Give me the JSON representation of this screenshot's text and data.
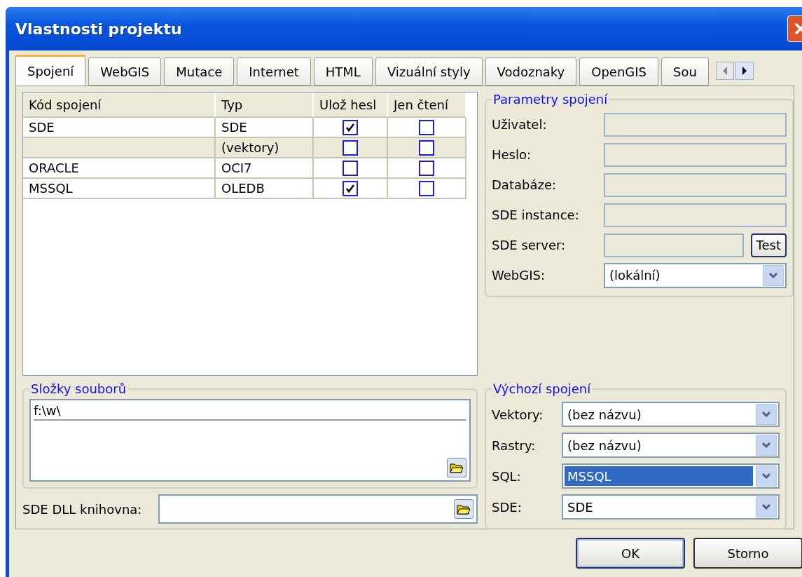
{
  "window": {
    "title": "Vlastnosti projektu"
  },
  "tabs": [
    {
      "label": "Spojení",
      "selected": true
    },
    {
      "label": "WebGIS",
      "selected": false
    },
    {
      "label": "Mutace",
      "selected": false
    },
    {
      "label": "Internet",
      "selected": false
    },
    {
      "label": "HTML",
      "selected": false
    },
    {
      "label": "Vizuální styly",
      "selected": false
    },
    {
      "label": "Vodoznaky",
      "selected": false
    },
    {
      "label": "OpenGIS",
      "selected": false
    },
    {
      "label": "Sou",
      "selected": false
    }
  ],
  "table": {
    "columns": [
      "Kód spojení",
      "Typ",
      "Ulož hesl",
      "Jen čtení"
    ],
    "rows": [
      {
        "code": "SDE",
        "type": "SDE",
        "save_password": true,
        "read_only": false,
        "selected": false
      },
      {
        "type": "(vektory)",
        "save_password": false,
        "read_only": false,
        "selected": true
      },
      {
        "code": "ORACLE",
        "type": "OCI7",
        "save_password": false,
        "read_only": false,
        "selected": false
      },
      {
        "code": "MSSQL",
        "type": "OLEDB",
        "save_password": true,
        "read_only": false,
        "selected": false
      }
    ]
  },
  "connection_params": {
    "title": "Parametry spojení",
    "fields": [
      {
        "label": "Uživatel:",
        "kind": "text"
      },
      {
        "label": "Heslo:",
        "kind": "text"
      },
      {
        "label": "Databáze:",
        "kind": "text"
      },
      {
        "label": "SDE instance:",
        "kind": "text"
      },
      {
        "label": "SDE server:",
        "kind": "button",
        "button": "Test"
      },
      {
        "label": "WebGIS:",
        "kind": "select",
        "value": "(lokální)"
      }
    ]
  },
  "folders": {
    "title": "Složky souborů",
    "items": [
      "f:\\w\\"
    ]
  },
  "dll": {
    "label": "SDE DLL knihovna:"
  },
  "default_connections": {
    "title": "Výchozí spojení",
    "fields": [
      {
        "label": "Vektory:",
        "value": "(bez názvu)",
        "selected": false
      },
      {
        "label": "Rastry:",
        "value": "(bez názvu)",
        "selected": false
      },
      {
        "label": "SQL:",
        "value": "MSSQL",
        "selected": true
      },
      {
        "label": "SDE:",
        "value": "SDE",
        "selected": false
      }
    ]
  },
  "buttons": [
    {
      "label": "OK",
      "default": true
    },
    {
      "label": "Storno",
      "default": false
    }
  ]
}
